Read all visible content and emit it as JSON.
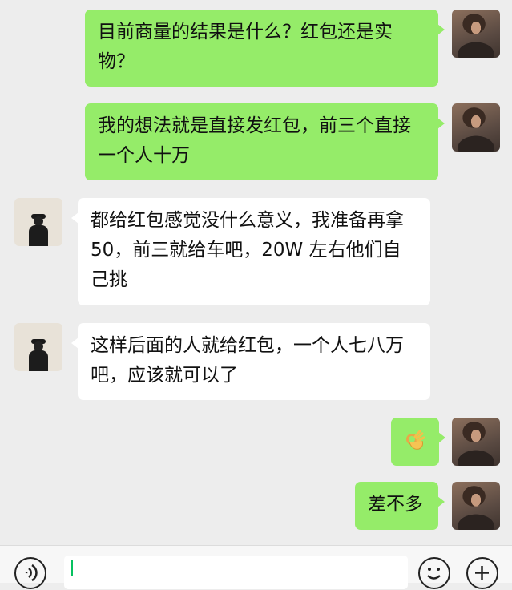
{
  "messages": [
    {
      "sender": "self",
      "text": "目前商量的结果是什么？红包还是实物？"
    },
    {
      "sender": "self",
      "text": "我的想法就是直接发红包，前三个直接一个人十万"
    },
    {
      "sender": "other",
      "text": "都给红包感觉没什么意义，我准备再拿 50，前三就给车吧，20W 左右他们自己挑"
    },
    {
      "sender": "other",
      "text": "这样后面的人就给红包，一个人七八万吧，应该就可以了"
    },
    {
      "sender": "self",
      "emoji": "ok-hand-emoji"
    },
    {
      "sender": "self",
      "text": "差不多"
    }
  ],
  "input_bar": {
    "voice_icon": "voice-icon",
    "emoji_icon": "emoji-icon",
    "plus_icon": "plus-icon",
    "input_value": ""
  },
  "colors": {
    "background": "#ededed",
    "self_bubble": "#95ec69",
    "other_bubble": "#ffffff",
    "caret": "#07c160"
  }
}
